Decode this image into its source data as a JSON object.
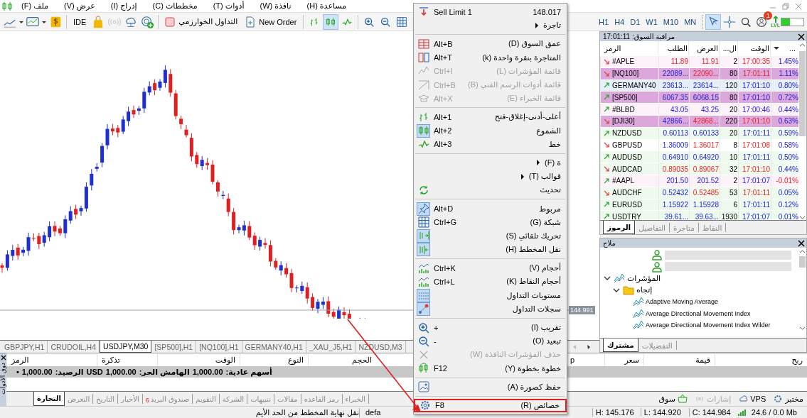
{
  "window": {
    "menu_bar": [
      "مساعدة (H)",
      "نافذة (W)",
      "أدوات (T)",
      "مخططات (C)",
      "إدراج (I)",
      "عرض (V)",
      "ملف (F)"
    ]
  },
  "toolbar": {
    "ide_label": "IDE",
    "algo_label": "التداول الخوارزمي",
    "new_order_label": "New Order",
    "bars_selected": false,
    "candles_selected": true,
    "line_selected": false,
    "timeframes": [
      {
        "label": "MN",
        "selected": false
      },
      {
        "label": "M10",
        "selected": false
      },
      {
        "label": "W1",
        "selected": false
      },
      {
        "label": "D1",
        "selected": false
      },
      {
        "label": "H4",
        "selected": false
      },
      {
        "label": "H1",
        "selected": false
      }
    ],
    "cursor_selected": true,
    "crosshair_selected": false,
    "notification_count": "1",
    "level_label": "LVL",
    "meter": {
      "level": 0.4
    }
  },
  "chart": {
    "price_label": "144.991"
  },
  "chart_tabs": [
    {
      "label": "NZDUSD,M3",
      "selected": false
    },
    {
      "label": "_XAU_J5,H1",
      "selected": false
    },
    {
      "label": "GERMANY40,H1",
      "selected": false
    },
    {
      "label": "[NQ100],H1",
      "selected": false
    },
    {
      "label": "[SP500],H1",
      "selected": false
    },
    {
      "label": "USDJPY,M30",
      "selected": true
    },
    {
      "label": "CRUDOIL,H4",
      "selected": false
    },
    {
      "label": "GBPJPY,H1",
      "selected": false
    }
  ],
  "context_menu": {
    "pointer_arrow": true,
    "items": [
      {
        "kind": "order",
        "label": "Sell Limit 1",
        "price": "148.017"
      },
      {
        "kind": "item",
        "label": "تاجرة",
        "submenu": true
      },
      {
        "kind": "separator"
      },
      {
        "kind": "item",
        "label": "عمق السوق (D)",
        "shortcut": "Alt+B"
      },
      {
        "kind": "item",
        "label": "المتاجرة بنقرة واحدة (k)",
        "shortcut": "Alt+T"
      },
      {
        "kind": "item",
        "label": "قائمة المؤشرات (L)",
        "shortcut": "Ctrl+I",
        "disabled": true
      },
      {
        "kind": "item",
        "label": "قائمة أدوات الرسم الفني (B)",
        "shortcut": "Ctrl+B",
        "disabled": true
      },
      {
        "kind": "item",
        "label": "قائمة الخبراء (E)",
        "shortcut": "Alt+X",
        "disabled": true
      },
      {
        "kind": "separator"
      },
      {
        "kind": "item",
        "label": "أعلى-أدنى-إغلاق-فتح",
        "shortcut": "Alt+1"
      },
      {
        "kind": "item",
        "label": "الشموع",
        "shortcut": "Alt+2",
        "checked": true
      },
      {
        "kind": "item",
        "label": "خط",
        "shortcut": "Alt+3"
      },
      {
        "kind": "separator"
      },
      {
        "kind": "item",
        "label": "ة (F)",
        "submenu": true
      },
      {
        "kind": "item",
        "label": "قوالب (T)",
        "submenu": true
      },
      {
        "kind": "item",
        "label": "تحديث"
      },
      {
        "kind": "separator"
      },
      {
        "kind": "item",
        "label": "مربوط",
        "shortcut": "Alt+D",
        "checked": true
      },
      {
        "kind": "item",
        "label": "شبكة (G)",
        "shortcut": "Ctrl+G"
      },
      {
        "kind": "item",
        "label": "تحريك تلقائي (S)",
        "checked": true
      },
      {
        "kind": "item",
        "label": "نقل المخطط (H)",
        "checked": true
      },
      {
        "kind": "separator"
      },
      {
        "kind": "item",
        "label": "أحجام (V)",
        "shortcut": "Ctrl+K"
      },
      {
        "kind": "item",
        "label": "أحجام النقاط (K)",
        "shortcut": "Ctrl+L"
      },
      {
        "kind": "item",
        "label": "مستويات التداول",
        "checked": true
      },
      {
        "kind": "item",
        "label": "سجلات التداول",
        "checked": true
      },
      {
        "kind": "separator"
      },
      {
        "kind": "item",
        "label": "تقريب (I)",
        "shortcut": "+"
      },
      {
        "kind": "item",
        "label": "تبعيد (O)",
        "shortcut": "-"
      },
      {
        "kind": "item",
        "label": "حذف المؤشرات النافذة (W)",
        "disabled": true
      },
      {
        "kind": "item",
        "label": "خطوة بخطوة (Y)",
        "shortcut": "F12"
      },
      {
        "kind": "separator"
      },
      {
        "kind": "item",
        "label": "حفظ كصورة (A)"
      },
      {
        "kind": "separator"
      },
      {
        "kind": "item",
        "label": "خصائص (R)",
        "shortcut": "F8",
        "highlighted": true
      }
    ]
  },
  "market_watch": {
    "title": "مراقبة السوق: 17:01:11",
    "columns": [
      "...",
      "الوقت",
      "ال...",
      "العرض",
      "الطلب",
      "الرمز"
    ],
    "rows": [
      {
        "symbol": "#APLE",
        "bid": "11.89",
        "ask": "11.91",
        "spread": "2",
        "time": "17:00:35",
        "change": "1.45%",
        "falling": true,
        "color": "#fdf1fa",
        "bid_down": true,
        "ask_down": true,
        "time_down": true,
        "change_down": false
      },
      {
        "symbol": "[NQ100]",
        "bid": "22089...",
        "ask": "22090...",
        "spread": "80",
        "time": "17:01:11",
        "change": "1.11%",
        "falling": true,
        "color": "#dca8dc",
        "bid_down": false,
        "ask_down": true,
        "time_down": true,
        "change_down": false
      },
      {
        "symbol": "GERMANY40",
        "bid": "23613...",
        "ask": "23614...",
        "spread": "120",
        "time": "17:01:10",
        "change": "0.80%",
        "falling": false,
        "color": "#e6f0fb",
        "bid_down": false,
        "ask_down": false,
        "time_down": false,
        "change_down": false
      },
      {
        "symbol": "[SP500]",
        "bid": "6067.35",
        "ask": "6068.15",
        "spread": "80",
        "time": "17:01:10",
        "change": "0.72%",
        "falling": false,
        "color": "#dca8dc",
        "bid_down": false,
        "ask_down": false,
        "time_down": false,
        "change_down": false
      },
      {
        "symbol": "#BLBD",
        "bid": "43.05",
        "ask": "43.25",
        "spread": "20",
        "time": "17:00:46",
        "change": "0.44%",
        "falling": false,
        "color": "#fdf1fa",
        "bid_down": false,
        "ask_down": false,
        "time_down": false,
        "change_down": false
      },
      {
        "symbol": "[DJI30]",
        "bid": "42866...",
        "ask": "42868...",
        "spread": "220",
        "time": "17:01:10",
        "change": "0.63%",
        "falling": true,
        "color": "#dca8dc",
        "bid_down": false,
        "ask_down": true,
        "time_down": true,
        "change_down": false
      },
      {
        "symbol": "NZDUSD",
        "bid": "0.60113",
        "ask": "0.60133",
        "spread": "20",
        "time": "17:01:11",
        "change": "0.59%",
        "falling": false,
        "color": "#effaef",
        "bid_down": false,
        "ask_down": false,
        "time_down": false,
        "change_down": false
      },
      {
        "symbol": "GBPUSD",
        "bid": "1.36009",
        "ask": "1.36017",
        "spread": "8",
        "time": "17:01:08",
        "change": "0.58%",
        "falling": true,
        "color": "#ffffff",
        "bid_down": false,
        "ask_down": true,
        "time_down": true,
        "change_down": false
      },
      {
        "symbol": "AUDUSD",
        "bid": "0.64910",
        "ask": "0.64920",
        "spread": "10",
        "time": "17:01:11",
        "change": "0.50%",
        "falling": false,
        "color": "#effaef",
        "bid_down": false,
        "ask_down": false,
        "time_down": false,
        "change_down": false
      },
      {
        "symbol": "AUDCAD",
        "bid": "0.89035",
        "ask": "0.89067",
        "spread": "32",
        "time": "17:01:10",
        "change": "0.44%",
        "falling": true,
        "color": "#effaef",
        "bid_down": true,
        "ask_down": true,
        "time_down": true,
        "change_down": false
      },
      {
        "symbol": "#AAPL",
        "bid": "201.50",
        "ask": "201.52",
        "spread": "2",
        "time": "17:01:07",
        "change": "-0.01%",
        "falling": false,
        "color": "#fdf1fa",
        "bid_down": false,
        "ask_down": false,
        "time_down": false,
        "change_down": true
      },
      {
        "symbol": "AUDCHF",
        "bid": "0.52432",
        "ask": "0.52485",
        "spread": "53",
        "time": "17:01:11",
        "change": "0.05%",
        "falling": true,
        "color": "#effaef",
        "bid_down": false,
        "ask_down": true,
        "time_down": true,
        "change_down": false
      },
      {
        "symbol": "EURUSD",
        "bid": "1.15922",
        "ask": "1.15928",
        "spread": "6",
        "time": "17:01:11",
        "change": "0.12%",
        "falling": false,
        "color": "#effaef",
        "bid_down": false,
        "ask_down": false,
        "time_down": false,
        "change_down": false
      },
      {
        "symbol": "USDTRY",
        "bid": "39.61...",
        "ask": "39.63...",
        "spread": "1930",
        "time": "17:01:07",
        "change": "0.01%",
        "falling": false,
        "color": "#effaef",
        "bid_down": false,
        "ask_down": false,
        "time_down": false,
        "change_down": false
      }
    ],
    "tabs": [
      {
        "label": "النقاط",
        "selected": false
      },
      {
        "label": "متاجرة",
        "selected": false
      },
      {
        "label": "التفاصيل",
        "selected": false
      },
      {
        "label": "الرموز",
        "selected": true
      }
    ]
  },
  "navigator": {
    "title": "ملاح",
    "tree": [
      {
        "kind": "account"
      },
      {
        "kind": "account"
      },
      {
        "kind": "group",
        "label": "المؤشرات",
        "expanded": true,
        "children": [
          {
            "kind": "folder",
            "label": "إتجاه",
            "expanded": true,
            "children": [
              {
                "kind": "indicator",
                "label": "Adaptive Moving Average"
              },
              {
                "kind": "indicator",
                "label": "Average Directional Movement Index"
              },
              {
                "kind": "indicator",
                "label": "Average Directional Movement Index Wilder"
              }
            ]
          }
        ]
      }
    ],
    "tabs": [
      {
        "label": "التفضيلات",
        "selected": false
      },
      {
        "label": "مشترك",
        "selected": true
      }
    ]
  },
  "toolbox": {
    "side_label": "دوق الأدوات",
    "columns": [
      "ربح",
      "قيمة",
      "سعر",
      "p",
      "الحجم",
      "النوع",
      "الوقت",
      "تذكرة",
      "الرمز"
    ],
    "balance": [
      "أسهم عادية:",
      "1,000.00",
      "الهامش الحر:",
      "1,000.00",
      "USD",
      "الرصيد:",
      "1,000.00",
      "•"
    ],
    "tabs": [
      {
        "label": "الخبراء",
        "selected": false
      },
      {
        "label": "رمز القاعده",
        "selected": false
      },
      {
        "label": "مقالات",
        "selected": false
      },
      {
        "label": "تنبيهات",
        "selected": false
      },
      {
        "label": "الشركة",
        "selected": false
      },
      {
        "label": "التقويم",
        "selected": false
      },
      {
        "label": "صندوق البريد",
        "selected": false,
        "badge": "6"
      },
      {
        "label": "الأخبار",
        "selected": false
      },
      {
        "label": "التاريخ",
        "selected": false
      },
      {
        "label": "التعرض",
        "selected": false
      },
      {
        "label": "التجارة",
        "selected": true
      }
    ],
    "right_tabs": [
      {
        "label": "مختبر",
        "disabled": false
      },
      {
        "label": "VPS",
        "disabled": false
      },
      {
        "label": "إشارات",
        "disabled": true
      },
      {
        "label": "سوق",
        "disabled": false
      }
    ]
  },
  "status_bar": {
    "hint": "نقل نهاية المخطط من الحد الأيم",
    "profile": "defa",
    "high": "H: 145.176",
    "low": "L: 144.920",
    "close": "C: 144.984",
    "traffic": "24.6 / 0.0 Mb"
  }
}
